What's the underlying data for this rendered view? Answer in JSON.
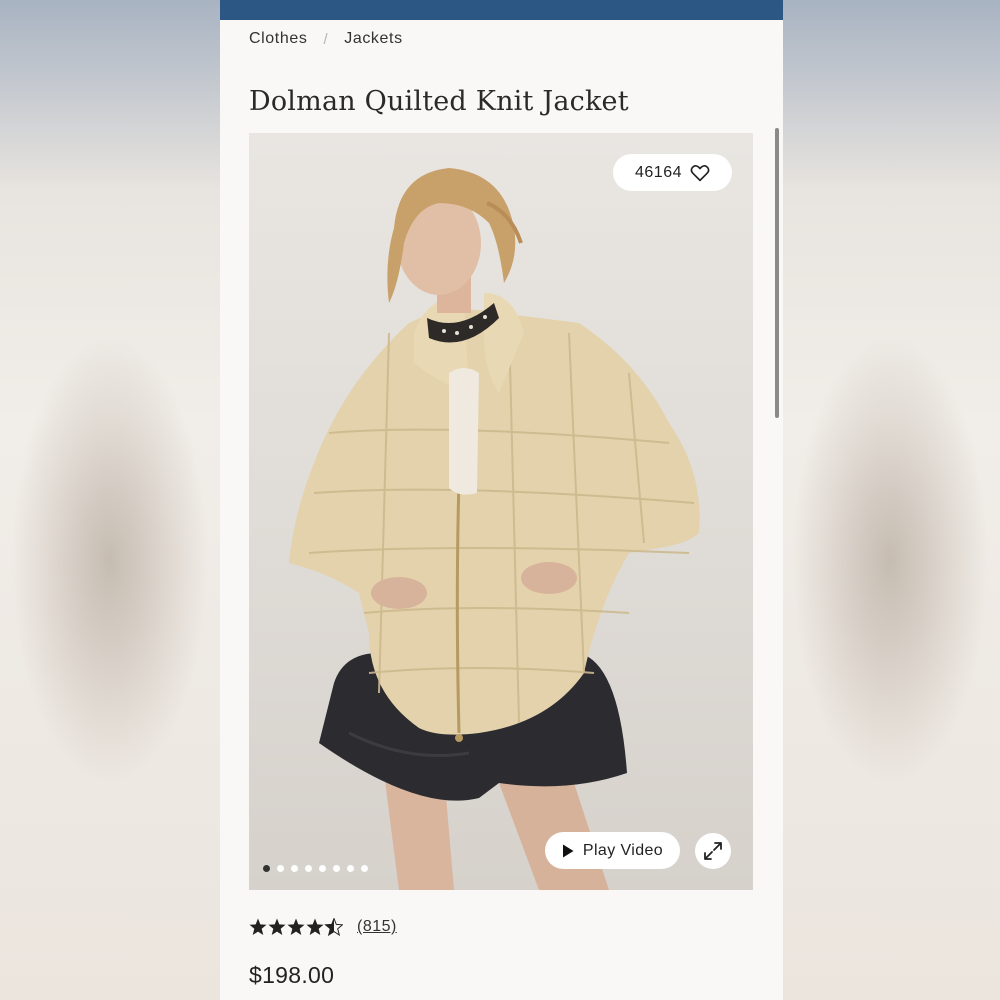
{
  "breadcrumb": {
    "items": [
      "Clothes",
      "Jackets"
    ],
    "separator": "/"
  },
  "product": {
    "title": "Dolman Quilted Knit Jacket",
    "likes_count": "46164",
    "play_video_label": "Play Video",
    "rating": 4.5,
    "review_count": "(815)",
    "price": "$198.00"
  },
  "gallery": {
    "total_images": 8,
    "active_index": 0
  },
  "colors": {
    "topbar": "#2c5784",
    "background": "#faf8f6",
    "jacket": "#e3d2ab",
    "shorts": "#2b2b30"
  },
  "icons": [
    "heart-icon",
    "play-icon",
    "expand-icon",
    "star-icon"
  ]
}
